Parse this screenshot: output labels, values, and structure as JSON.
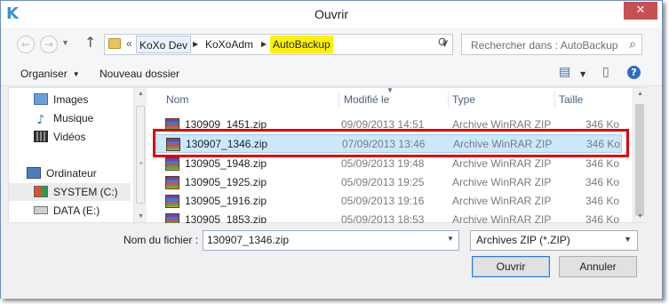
{
  "window": {
    "title": "Ouvrir",
    "app_icon": "K",
    "close_glyph": "✕"
  },
  "navbar": {
    "back_glyph": "←",
    "forward_glyph": "→",
    "up_glyph": "↑",
    "breadcrumb": {
      "prefix": "«",
      "items": [
        "KoXo Dev",
        "KoXoAdm",
        "AutoBackup"
      ],
      "highlight_color": "#fff200"
    },
    "search_placeholder": "Rechercher dans : AutoBackup"
  },
  "toolbar": {
    "organize_label": "Organiser",
    "new_folder_label": "Nouveau dossier"
  },
  "sidebar": {
    "items": [
      {
        "label": "Images",
        "icon": "images-icon"
      },
      {
        "label": "Musique",
        "icon": "music-icon"
      },
      {
        "label": "Vidéos",
        "icon": "videos-icon"
      },
      {
        "label": "Ordinateur",
        "icon": "computer-icon"
      },
      {
        "label": "SYSTEM (C:)",
        "icon": "system-drive-icon"
      },
      {
        "label": "DATA (E:)",
        "icon": "data-drive-icon"
      }
    ]
  },
  "file_list": {
    "columns": [
      "Nom",
      "Modifié le",
      "Type",
      "Taille"
    ],
    "rows": [
      {
        "name": "130909_1451.zip",
        "date": "09/09/2013 14:51",
        "type": "Archive WinRAR ZIP",
        "size": "346 Ko"
      },
      {
        "name": "130907_1346.zip",
        "date": "07/09/2013 13:46",
        "type": "Archive WinRAR ZIP",
        "size": "346 Ko"
      },
      {
        "name": "130905_1948.zip",
        "date": "05/09/2013 19:48",
        "type": "Archive WinRAR ZIP",
        "size": "346 Ko"
      },
      {
        "name": "130905_1925.zip",
        "date": "05/09/2013 19:25",
        "type": "Archive WinRAR ZIP",
        "size": "346 Ko"
      },
      {
        "name": "130905_1916.zip",
        "date": "05/09/2013 19:16",
        "type": "Archive WinRAR ZIP",
        "size": "346 Ko"
      },
      {
        "name": "130905_1853.zip",
        "date": "05/09/2013 18:53",
        "type": "Archive WinRAR ZIP",
        "size": "346 Ko"
      }
    ],
    "selected_index": 1,
    "highlight_color": "#e00000"
  },
  "footer": {
    "filename_label": "Nom du fichier :",
    "filename_value": "130907_1346.zip",
    "filetype_value": "Archives ZIP (*.ZIP)",
    "open_label": "Ouvrir",
    "cancel_label": "Annuler"
  }
}
